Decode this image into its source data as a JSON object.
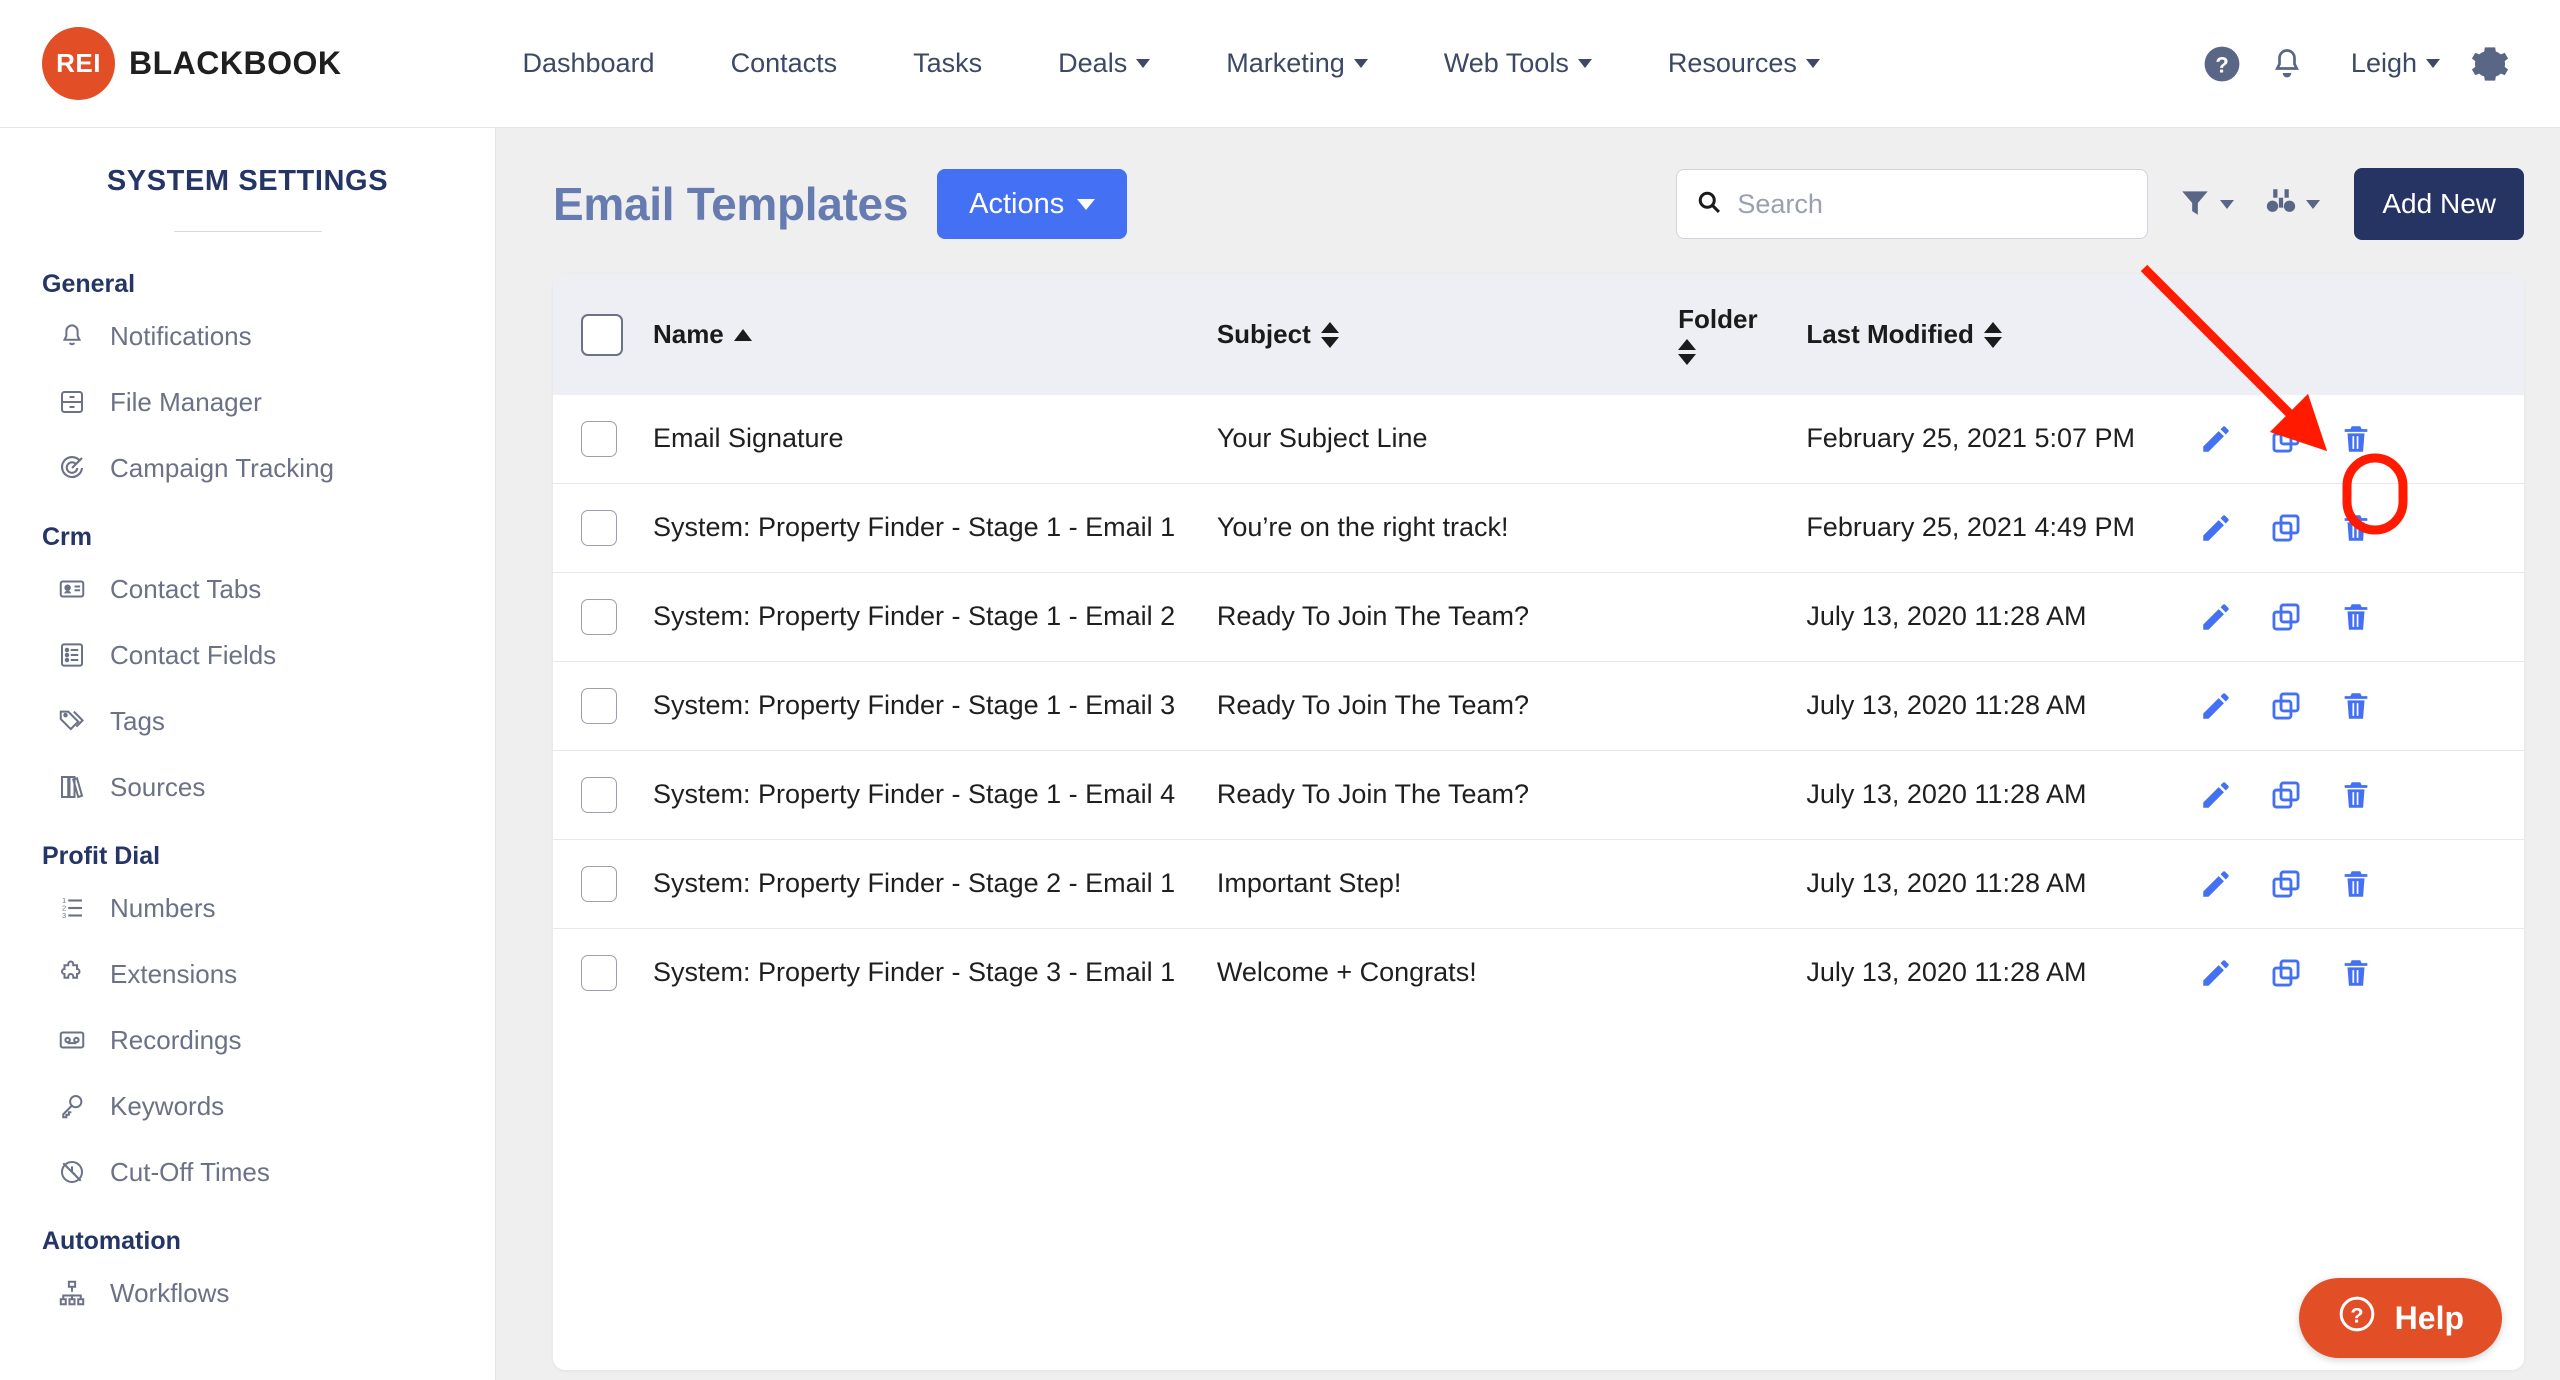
{
  "brand": {
    "mark": "REI",
    "name": "BLACKBOOK",
    "mark_color": "#E24E26"
  },
  "topnav": {
    "links": [
      {
        "label": "Dashboard",
        "has_caret": false
      },
      {
        "label": "Contacts",
        "has_caret": false
      },
      {
        "label": "Tasks",
        "has_caret": false
      },
      {
        "label": "Deals",
        "has_caret": true
      },
      {
        "label": "Marketing",
        "has_caret": true
      },
      {
        "label": "Web Tools",
        "has_caret": true
      },
      {
        "label": "Resources",
        "has_caret": true
      }
    ],
    "help_icon": "question-circle-icon",
    "bell_icon": "bell-icon",
    "user": "Leigh",
    "gear_icon": "gear-icon"
  },
  "sidebar": {
    "title": "SYSTEM SETTINGS",
    "groups": [
      {
        "label": "General",
        "items": [
          {
            "label": "Notifications",
            "icon": "bell-icon"
          },
          {
            "label": "File Manager",
            "icon": "file-drawer-icon"
          },
          {
            "label": "Campaign Tracking",
            "icon": "campaign-target-icon"
          }
        ]
      },
      {
        "label": "Crm",
        "items": [
          {
            "label": "Contact Tabs",
            "icon": "contact-card-icon"
          },
          {
            "label": "Contact Fields",
            "icon": "list-fields-icon"
          },
          {
            "label": "Tags",
            "icon": "tag-icon"
          },
          {
            "label": "Sources",
            "icon": "books-icon"
          }
        ]
      },
      {
        "label": "Profit Dial",
        "items": [
          {
            "label": "Numbers",
            "icon": "numbered-list-icon"
          },
          {
            "label": "Extensions",
            "icon": "puzzle-piece-icon"
          },
          {
            "label": "Recordings",
            "icon": "cassette-tape-icon"
          },
          {
            "label": "Keywords",
            "icon": "key-icon"
          },
          {
            "label": "Cut-Off Times",
            "icon": "no-clock-icon"
          }
        ]
      },
      {
        "label": "Automation",
        "items": [
          {
            "label": "Workflows",
            "icon": "sitemap-icon"
          }
        ]
      }
    ]
  },
  "page": {
    "title": "Email Templates",
    "actions_label": "Actions",
    "add_new_label": "Add New",
    "search_placeholder": "Search",
    "search_value": "",
    "filter_icon": "funnel-icon",
    "view_icon": "binoculars-icon",
    "search_icon": "search-icon"
  },
  "table": {
    "columns": [
      {
        "key": "check",
        "label": "",
        "sort": "none"
      },
      {
        "key": "name",
        "label": "Name",
        "sort": "asc"
      },
      {
        "key": "subject",
        "label": "Subject",
        "sort": "both"
      },
      {
        "key": "folder",
        "label": "Folder",
        "sort": "both"
      },
      {
        "key": "modified",
        "label": "Last Modified",
        "sort": "both"
      },
      {
        "key": "actions",
        "label": "",
        "sort": "none"
      }
    ],
    "rows": [
      {
        "name": "Email Signature",
        "subject": "Your Subject Line",
        "folder": "",
        "modified": "February 25, 2021 5:07 PM"
      },
      {
        "name": "System: Property Finder - Stage 1 - Email 1",
        "subject": "You’re on the right track!",
        "folder": "",
        "modified": "February 25, 2021 4:49 PM"
      },
      {
        "name": "System: Property Finder - Stage 1 - Email 2",
        "subject": "Ready To Join The Team?",
        "folder": "",
        "modified": "July 13, 2020 11:28 AM"
      },
      {
        "name": "System: Property Finder - Stage 1 - Email 3",
        "subject": "Ready To Join The Team?",
        "folder": "",
        "modified": "July 13, 2020 11:28 AM"
      },
      {
        "name": "System: Property Finder - Stage 1 - Email 4",
        "subject": "Ready To Join The Team?",
        "folder": "",
        "modified": "July 13, 2020 11:28 AM"
      },
      {
        "name": "System: Property Finder - Stage 2 - Email 1",
        "subject": "Important Step!",
        "folder": "",
        "modified": "July 13, 2020 11:28 AM"
      },
      {
        "name": "System: Property Finder - Stage 3 - Email 1",
        "subject": "Welcome + Congrats!",
        "folder": "",
        "modified": "July 13, 2020 11:28 AM"
      }
    ],
    "row_action_icons": [
      "pencil-icon",
      "duplicate-icon",
      "trash-icon"
    ],
    "action_icon_color": "#4470F4"
  },
  "annotation": {
    "color": "#FF1A00",
    "arrow": "red-arrow-pointing-to-duplicate-icon",
    "highlight": "red-oval-around-duplicate-icon"
  },
  "help_widget": {
    "label": "Help",
    "icon": "question-circle-icon",
    "color": "#E24E26"
  }
}
